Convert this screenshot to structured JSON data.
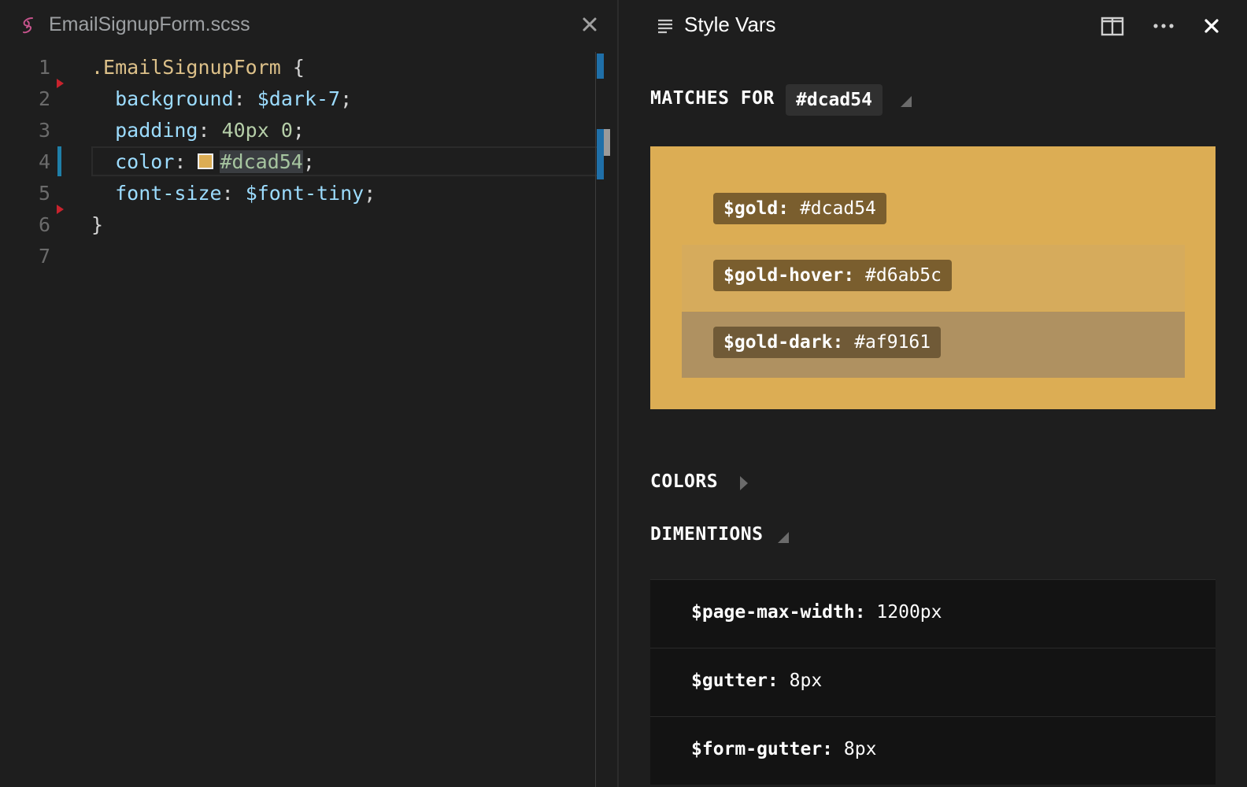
{
  "editor": {
    "file_name": "EmailSignupForm.scss",
    "lines": [
      {
        "num": "1",
        "selector": ".EmailSignupForm",
        "brace": " {"
      },
      {
        "num": "2",
        "prop": "background",
        "colon": ": ",
        "value": "$dark-7",
        "semi": ";"
      },
      {
        "num": "3",
        "prop": "padding",
        "colon": ": ",
        "value": "40px 0",
        "semi": ";"
      },
      {
        "num": "4",
        "prop": "color",
        "colon": ": ",
        "value": "#dcad54",
        "semi": ";"
      },
      {
        "num": "5",
        "prop": "font-size",
        "colon": ": ",
        "value": "$font-tiny",
        "semi": ";"
      },
      {
        "num": "6",
        "brace": "}"
      },
      {
        "num": "7"
      }
    ]
  },
  "panel": {
    "title": "Style Vars",
    "matches_label": "MATCHES FOR",
    "matches_hex": "#dcad54",
    "match_color": "#dcad54",
    "matches": [
      {
        "name": "$gold:",
        "value": "#dcad54",
        "color": "#dcad54"
      },
      {
        "name": "$gold-hover:",
        "value": "#d6ab5c",
        "color": "#d6ab5c"
      },
      {
        "name": "$gold-dark:",
        "value": "#af9161",
        "color": "#af9161"
      }
    ],
    "colors_label": "COLORS",
    "dimensions_label": "DIMENTIONS",
    "dimensions": [
      {
        "name": "$page-max-width:",
        "value": "1200px"
      },
      {
        "name": "$gutter:",
        "value": "8px"
      },
      {
        "name": "$form-gutter:",
        "value": "8px"
      }
    ]
  },
  "icons": {
    "file_icon": "sass-file-icon",
    "tab_close": "close-icon",
    "panel_list": "list-icon",
    "split": "split-editor-icon",
    "more": "more-icon",
    "panel_close": "close-icon"
  }
}
